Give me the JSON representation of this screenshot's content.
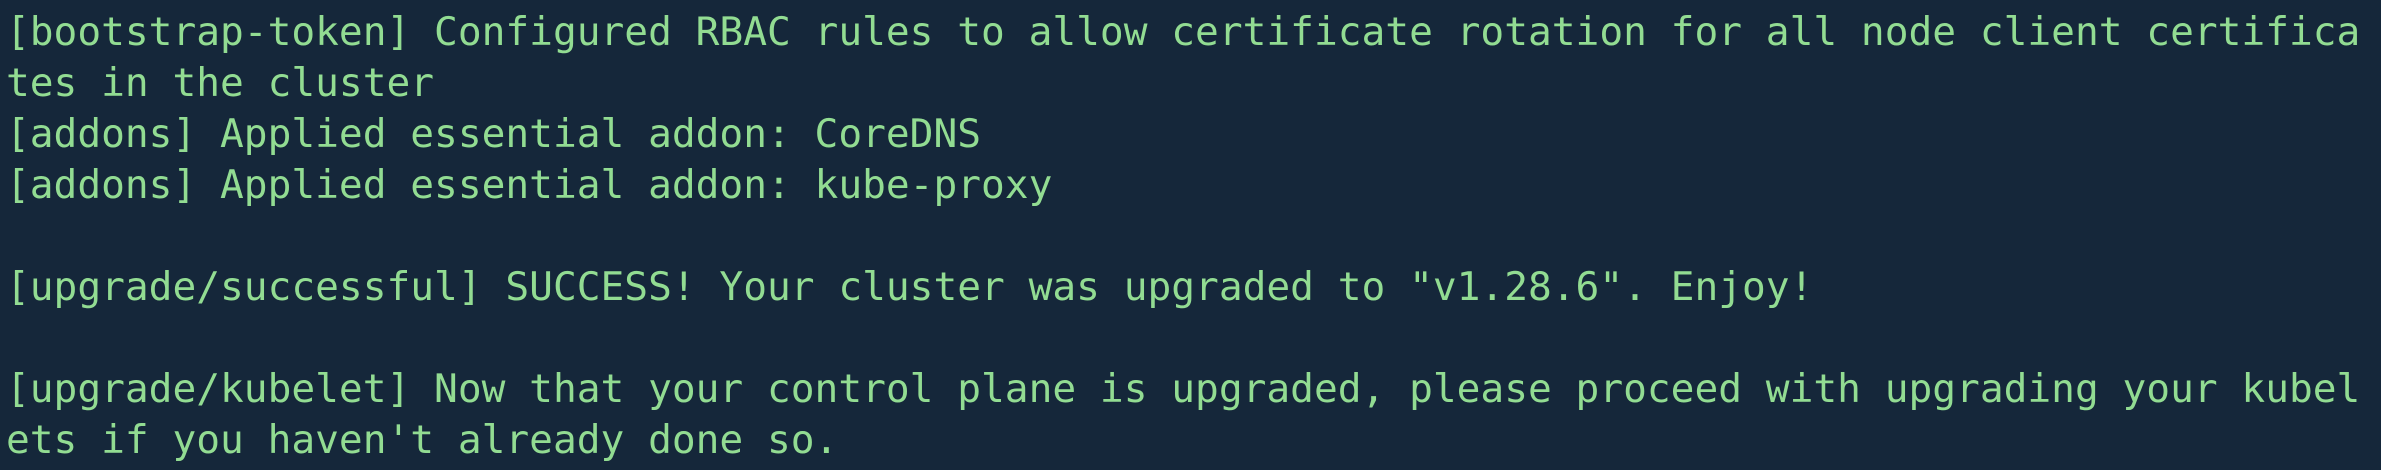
{
  "terminal": {
    "colors": {
      "background": "#15273a",
      "foreground": "#92dc92"
    },
    "lines": [
      "[bootstrap-token] Configured RBAC rules to allow certificate rotation for all node client certifica",
      "tes in the cluster",
      "[addons] Applied essential addon: CoreDNS",
      "[addons] Applied essential addon: kube-proxy",
      "",
      "[upgrade/successful] SUCCESS! Your cluster was upgraded to \"v1.28.6\". Enjoy!",
      "",
      "[upgrade/kubelet] Now that your control plane is upgraded, please proceed with upgrading your kubel",
      "ets if you haven't already done so."
    ]
  }
}
